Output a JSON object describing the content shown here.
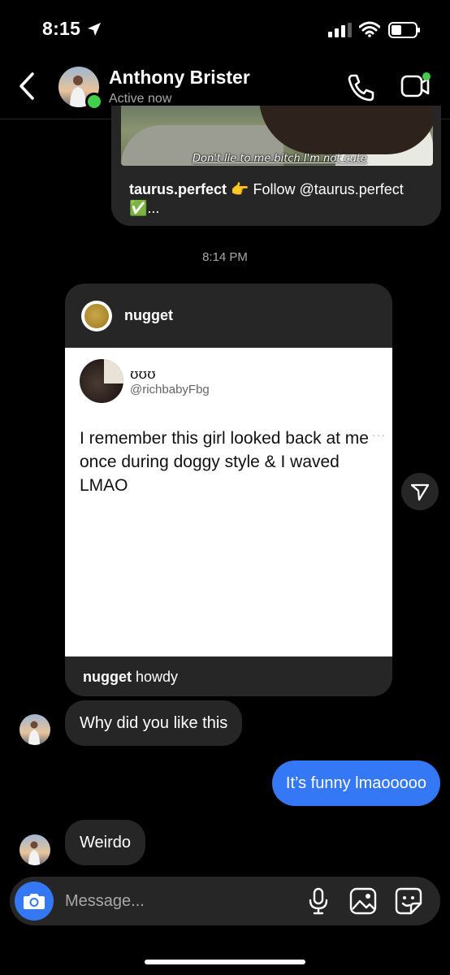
{
  "status_bar": {
    "time": "8:15"
  },
  "header": {
    "contact_name": "Anthony Brister",
    "contact_status": "Active now"
  },
  "shared_reel": {
    "thumbnail_caption": "Don't lie to me bitch I'm not cute",
    "author": "taurus.perfect",
    "caption_rest": " 👉 Follow @taurus.perfect ✅..."
  },
  "timestamp": "8:14 PM",
  "shared_post": {
    "username": "nugget",
    "tweet_display_name": "ʊʊʊ",
    "tweet_handle": "@richbabyFbg",
    "tweet_more": "···",
    "tweet_text": "I remember this girl looked back at me once during doggy style & I waved LMAO",
    "caption_user": "nugget",
    "caption_text": " howdy"
  },
  "messages": [
    {
      "direction": "incoming",
      "text": "Why did you like this"
    },
    {
      "direction": "outgoing",
      "text": "It’s funny lmaooooo"
    },
    {
      "direction": "incoming",
      "text": "Weirdo"
    }
  ],
  "composer": {
    "placeholder": "Message..."
  },
  "colors": {
    "background": "#000000",
    "incoming_bubble": "#262626",
    "outgoing_bubble": "#3478f6",
    "online": "#3fcf4a"
  },
  "icons": [
    "location-arrow-icon",
    "signal-icon",
    "wifi-icon",
    "battery-icon",
    "back-chevron-icon",
    "phone-icon",
    "video-camera-icon",
    "send-icon",
    "camera-icon",
    "microphone-icon",
    "gallery-icon",
    "sticker-icon"
  ]
}
